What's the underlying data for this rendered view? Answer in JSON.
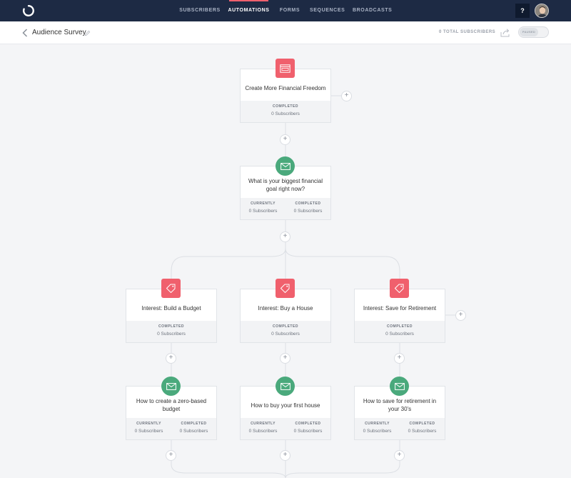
{
  "nav": {
    "items": [
      {
        "label": "SUBSCRIBERS",
        "active": false
      },
      {
        "label": "AUTOMATIONS",
        "active": true
      },
      {
        "label": "FORMS",
        "active": false
      },
      {
        "label": "SEQUENCES",
        "active": false
      },
      {
        "label": "BROADCASTS",
        "active": false
      }
    ],
    "help_label": "?",
    "accent_color": "#f0606d",
    "bg_color": "#1d2a44"
  },
  "header": {
    "title": "Audience Survey",
    "total_subscribers": "0 TOTAL SUBSCRIBERS",
    "toggle_label": "PAUSED"
  },
  "nodes": {
    "trigger": {
      "title": "Create More Financial Freedom",
      "icon": "form-icon",
      "stats": [
        {
          "label": "COMPLETED",
          "value": "0 Subscribers"
        }
      ]
    },
    "survey_email": {
      "title": "What is your biggest financial goal right now?",
      "icon": "envelope-icon",
      "stats": [
        {
          "label": "CURRENTLY",
          "value": "0 Subscribers"
        },
        {
          "label": "COMPLETED",
          "value": "0 Subscribers"
        }
      ]
    },
    "tag_budget": {
      "title": "Interest: Build a Budget",
      "icon": "tag-icon",
      "stats": [
        {
          "label": "COMPLETED",
          "value": "0 Subscribers"
        }
      ]
    },
    "tag_house": {
      "title": "Interest: Buy a House",
      "icon": "tag-icon",
      "stats": [
        {
          "label": "COMPLETED",
          "value": "0 Subscribers"
        }
      ]
    },
    "tag_retirement": {
      "title": "Interest: Save for Retirement",
      "icon": "tag-icon",
      "stats": [
        {
          "label": "COMPLETED",
          "value": "0 Subscribers"
        }
      ]
    },
    "email_budget": {
      "title": "How to create a zero-based budget",
      "icon": "envelope-icon",
      "stats": [
        {
          "label": "CURRENTLY",
          "value": "0 Subscribers"
        },
        {
          "label": "COMPLETED",
          "value": "0 Subscribers"
        }
      ]
    },
    "email_house": {
      "title": "How to buy your first house",
      "icon": "envelope-icon",
      "stats": [
        {
          "label": "CURRENTLY",
          "value": "0 Subscribers"
        },
        {
          "label": "COMPLETED",
          "value": "0 Subscribers"
        }
      ]
    },
    "email_retirement": {
      "title": "How to save for retirement in your 30's",
      "icon": "envelope-icon",
      "stats": [
        {
          "label": "CURRENTLY",
          "value": "0 Subscribers"
        },
        {
          "label": "COMPLETED",
          "value": "0 Subscribers"
        }
      ]
    }
  },
  "plus_label": "+"
}
